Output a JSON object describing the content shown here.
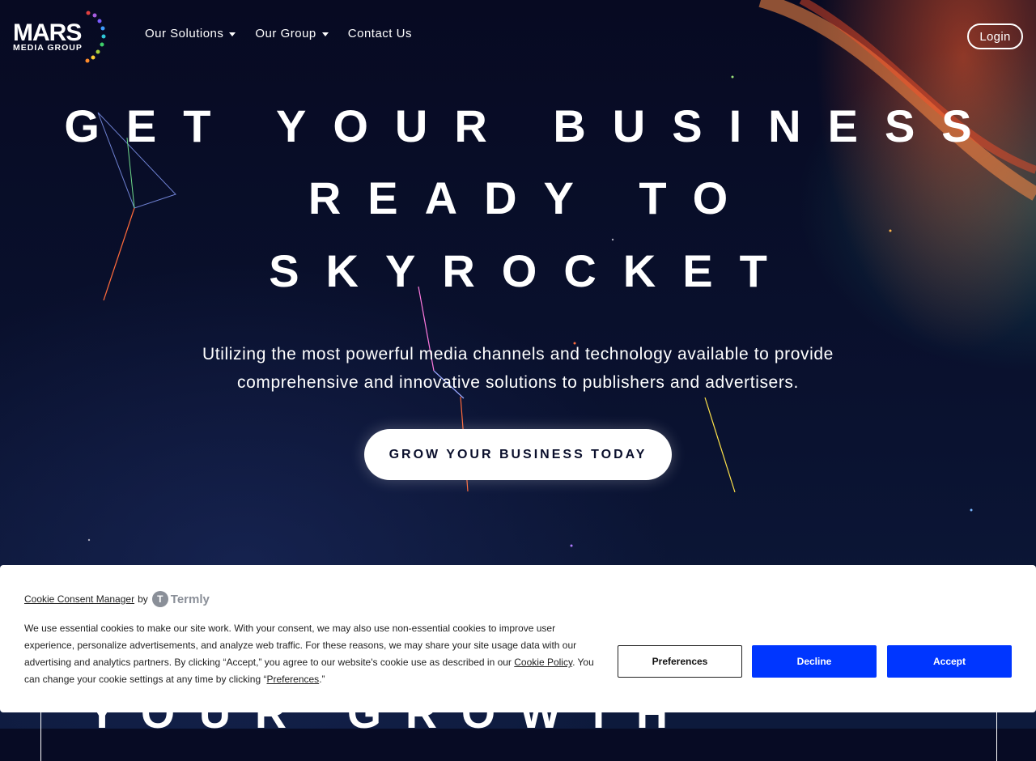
{
  "header": {
    "logo": {
      "word": "MARS",
      "sub": "MEDIA GROUP"
    },
    "nav": [
      {
        "label": "Our Solutions",
        "dropdown": true
      },
      {
        "label": "Our Group",
        "dropdown": true
      },
      {
        "label": "Contact Us",
        "dropdown": false
      }
    ],
    "login_label": "Login"
  },
  "hero": {
    "lines": [
      "GET YOUR BUSINESS",
      "READY TO",
      "SKYROCKET"
    ],
    "subtitle_line1": "Utilizing the most powerful media channels and technology available to provide",
    "subtitle_line2": "comprehensive and innovative solutions to publishers and advertisers.",
    "cta_label": "GROW YOUR BUSINESS TODAY"
  },
  "below_fold_text": "YOUR GROWTH",
  "cookie_banner": {
    "manager_label": "Cookie Consent Manager",
    "by_label": "by",
    "provider": "Termly",
    "body_part1": "We use essential cookies to make our site work. With your consent, we may also use non-essential cookies to improve user experience, personalize advertisements, and analyze web traffic. For these reasons, we may share your site usage data with our advertising and analytics partners. By clicking “Accept,” you agree to our website's cookie use as described in our ",
    "policy_link": "Cookie Policy",
    "body_part2": ". You can change your cookie settings at any time by clicking “",
    "preferences_link": "Preferences",
    "body_part3": ".”",
    "buttons": {
      "preferences": "Preferences",
      "decline": "Decline",
      "accept": "Accept"
    }
  },
  "colors": {
    "background": "#070b24",
    "button_blue": "#0036ff",
    "cta_text": "#0a0f2c"
  },
  "icons": [
    "caret-down-icon",
    "termly-logo-icon",
    "logo-dots-icon"
  ]
}
